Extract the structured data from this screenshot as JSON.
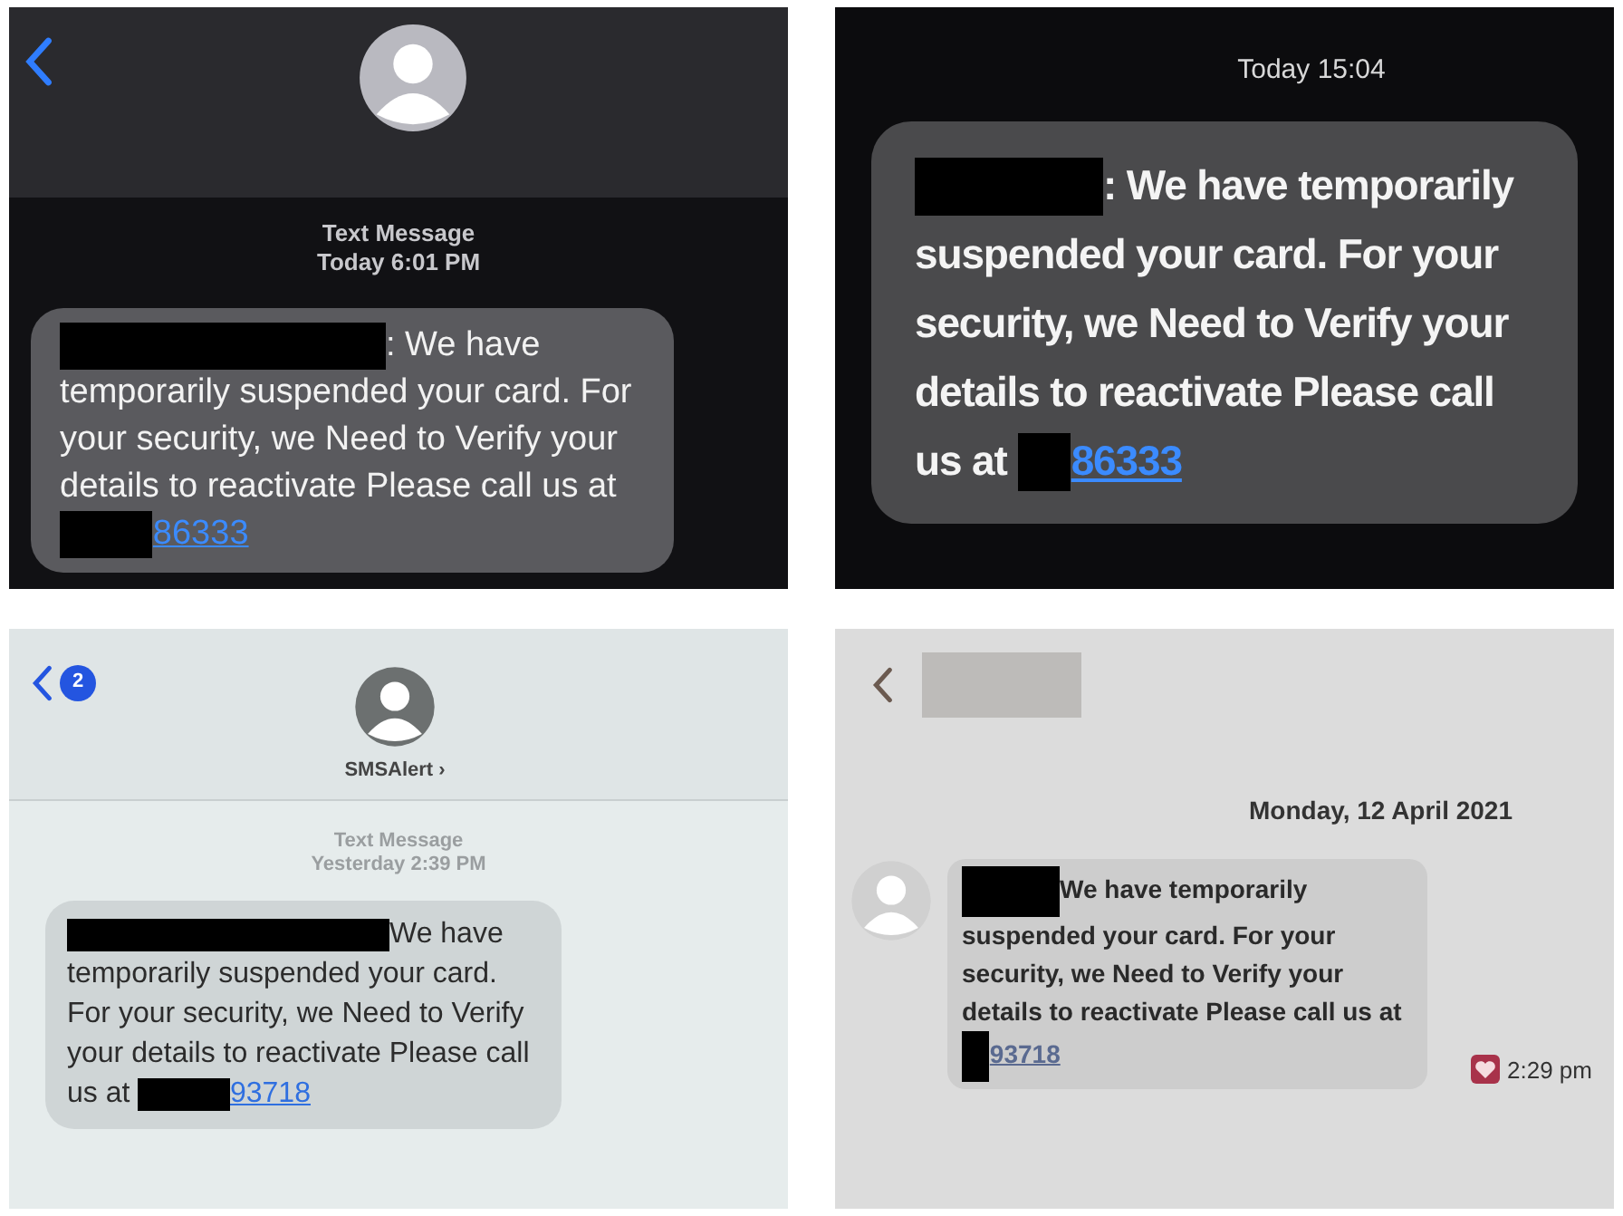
{
  "panels": [
    {
      "kind": "ios-dark",
      "stamp": [
        "Text Message",
        "Today 6:01 PM"
      ],
      "message": {
        "text": ": We have temporarily suspended your card. For your security, we Need to Verify your details to reactivate Please call us at",
        "link": "86333"
      }
    },
    {
      "kind": "ios-dark-plain",
      "stamp": [
        "Today 15:04"
      ],
      "message": {
        "text": ": We have temporarily suspended your card. For your security, we Need to Verify your details to reactivate Please call us at",
        "link": "86333"
      }
    },
    {
      "kind": "ios-light",
      "badge": "2",
      "name": "SMSAlert ›",
      "stamp": [
        "Text Message",
        "Yesterday 2:39 PM"
      ],
      "message": {
        "text": "We have temporarily suspended your card. For your security, we Need to Verify your details to reactivate Please call us at",
        "link": "93718"
      }
    },
    {
      "kind": "android",
      "stamp": [
        "Monday, 12 April 2021"
      ],
      "message": {
        "text": "We have temporarily suspended your card. For your security, we Need to Verify your details to reactivate Please call us at",
        "link": "93718"
      },
      "time": "2:29 pm"
    }
  ]
}
